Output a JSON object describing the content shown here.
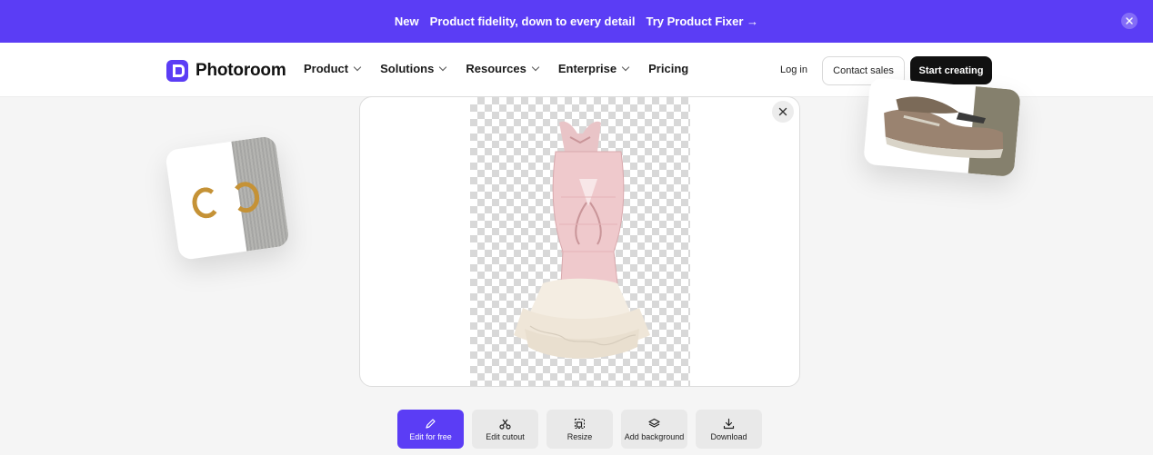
{
  "announcement": {
    "badge": "New",
    "message": "Product fidelity, down to every detail",
    "cta": "Try Product Fixer →"
  },
  "brand": {
    "name": "Photoroom",
    "accent": "#5b3df5"
  },
  "nav": {
    "items": [
      "Product",
      "Solutions",
      "Resources",
      "Enterprise",
      "Pricing"
    ],
    "login": "Log in",
    "contact": "Contact sales",
    "start": "Start creating"
  },
  "toolbar": {
    "edit": "Edit for free",
    "cutout": "Edit cutout",
    "resize": "Resize",
    "background": "Add background",
    "download": "Download"
  }
}
